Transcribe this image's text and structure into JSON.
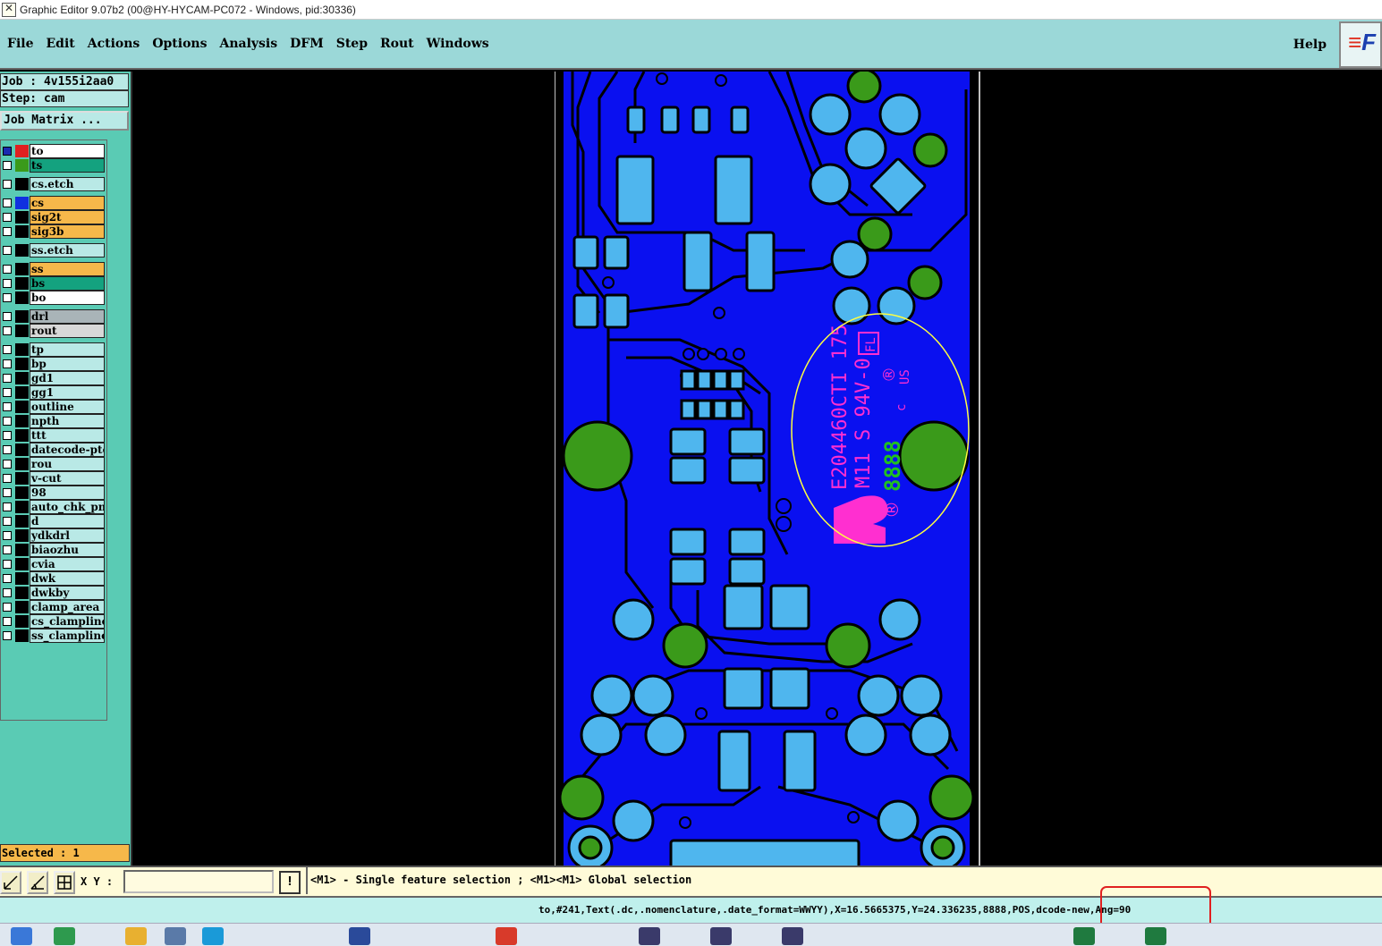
{
  "window": {
    "title": "Graphic Editor 9.07b2 (00@HY-HYCAM-PC072 - Windows, pid:30336)"
  },
  "menubar": {
    "items": [
      {
        "label": "File"
      },
      {
        "label": "Edit"
      },
      {
        "label": "Actions"
      },
      {
        "label": "Options"
      },
      {
        "label": "Analysis"
      },
      {
        "label": "DFM"
      },
      {
        "label": "Step"
      },
      {
        "label": "Rout"
      },
      {
        "label": "Windows"
      }
    ],
    "help": "Help",
    "logo_text": "F"
  },
  "panel": {
    "job": "Job : 4v155i2aa0",
    "step": "Step: cam",
    "job_matrix": "Job Matrix ...",
    "selected": "Selected : 1"
  },
  "layers": [
    {
      "name": "to",
      "color": "#ffffff",
      "swatch": "#e02020"
    },
    {
      "name": "ts",
      "color": "#14a27f",
      "swatch": "#3a9a1a"
    },
    {
      "name": "cs.etch",
      "color": "#b9e9e6",
      "swatch": "#000000"
    },
    {
      "name": "cs",
      "color": "#f6b84a",
      "swatch": "#1030e0"
    },
    {
      "name": "sig2t",
      "color": "#f6b84a",
      "swatch": "#000000"
    },
    {
      "name": "sig3b",
      "color": "#f6b84a",
      "swatch": "#000000"
    },
    {
      "name": "ss.etch",
      "color": "#b9e9e6",
      "swatch": "#000000"
    },
    {
      "name": "ss",
      "color": "#f6b84a",
      "swatch": "#000000"
    },
    {
      "name": "bs",
      "color": "#14a27f",
      "swatch": "#000000"
    },
    {
      "name": "bo",
      "color": "#ffffff",
      "swatch": "#000000"
    },
    {
      "name": "drl",
      "color": "#a9b4b8",
      "swatch": "#000000"
    },
    {
      "name": "rout",
      "color": "#d8d8d8",
      "swatch": "#000000"
    },
    {
      "name": "tp",
      "color": "#b9e9e6",
      "swatch": "#000000"
    },
    {
      "name": "bp",
      "color": "#b9e9e6",
      "swatch": "#000000"
    },
    {
      "name": "gd1",
      "color": "#b9e9e6",
      "swatch": "#000000"
    },
    {
      "name": "gg1",
      "color": "#b9e9e6",
      "swatch": "#000000"
    },
    {
      "name": "outline",
      "color": "#b9e9e6",
      "swatch": "#000000"
    },
    {
      "name": "npth",
      "color": "#b9e9e6",
      "swatch": "#000000"
    },
    {
      "name": "ttt",
      "color": "#b9e9e6",
      "swatch": "#000000"
    },
    {
      "name": "datecode-pte",
      "color": "#b9e9e6",
      "swatch": "#000000"
    },
    {
      "name": "rou",
      "color": "#b9e9e6",
      "swatch": "#000000"
    },
    {
      "name": "v-cut",
      "color": "#b9e9e6",
      "swatch": "#000000"
    },
    {
      "name": "98",
      "color": "#b9e9e6",
      "swatch": "#000000"
    },
    {
      "name": "auto_chk_pnl",
      "color": "#b9e9e6",
      "swatch": "#000000"
    },
    {
      "name": "d",
      "color": "#b9e9e6",
      "swatch": "#000000"
    },
    {
      "name": "ydkdrl",
      "color": "#b9e9e6",
      "swatch": "#000000"
    },
    {
      "name": "biaozhu",
      "color": "#b9e9e6",
      "swatch": "#000000"
    },
    {
      "name": "cvia",
      "color": "#b9e9e6",
      "swatch": "#000000"
    },
    {
      "name": "dwk",
      "color": "#b9e9e6",
      "swatch": "#000000"
    },
    {
      "name": "dwkby",
      "color": "#b9e9e6",
      "swatch": "#000000"
    },
    {
      "name": "clamp_area",
      "color": "#b9e9e6",
      "swatch": "#000000"
    },
    {
      "name": "cs_clampline",
      "color": "#b9e9e6",
      "swatch": "#000000"
    },
    {
      "name": "ss_clampline",
      "color": "#b9e9e6",
      "swatch": "#000000"
    }
  ],
  "board": {
    "silk_text_1": "E204460CTI 175",
    "silk_text_2": "M11 S 94V-0",
    "datecode": "8888",
    "ul_mark": "FL",
    "us_mark": "US",
    "c_mark": "c",
    "reg_mark": "®",
    "colors": {
      "laminate": "#0a10f0",
      "copper": "#4fb6ee",
      "drill": "#3a9a1a",
      "silk": "#ff2fd0",
      "datecode": "#20c020",
      "highlight": "#ffff40"
    }
  },
  "statusbar": {
    "xy_label": "X Y :",
    "xy_value": "",
    "warn_icon": "!",
    "hint": "<M1> - Single feature selection ; <M1><M1> Global selection",
    "feature_info": "to,#241,Text(.dc,.nomenclature,.date_format=WWYY),X=16.5665375,Y=24.336235,8888,POS,dcode-new,Ang=90"
  }
}
